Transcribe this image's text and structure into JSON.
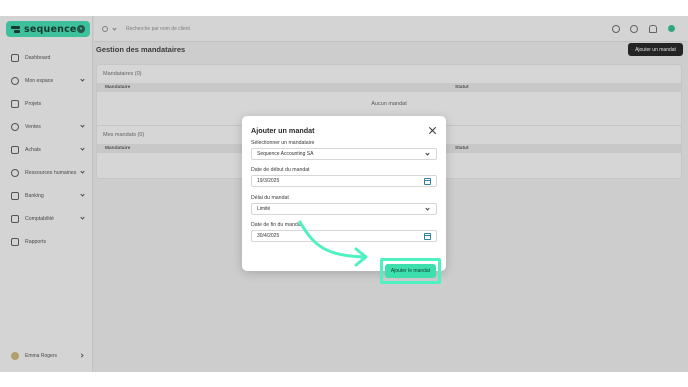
{
  "brand": {
    "name": "sequence",
    "color": "#3dd9ad"
  },
  "sidebar": {
    "items": [
      {
        "label": "Dashboard",
        "icon": "home-icon",
        "chevron": false
      },
      {
        "label": "Mon espace",
        "icon": "person-icon",
        "chevron": true
      },
      {
        "label": "Projets",
        "icon": "checklist-icon",
        "chevron": false
      },
      {
        "label": "Ventes",
        "icon": "wallet-icon",
        "chevron": true
      },
      {
        "label": "Achats",
        "icon": "bag-icon",
        "chevron": true
      },
      {
        "label": "Ressources humaines",
        "icon": "people-icon",
        "chevron": true
      },
      {
        "label": "Banking",
        "icon": "bank-icon",
        "chevron": true
      },
      {
        "label": "Comptabilité",
        "icon": "calculator-icon",
        "chevron": true
      },
      {
        "label": "Rapports",
        "icon": "chart-icon",
        "chevron": false
      }
    ],
    "user": {
      "name": "Emma Rogers"
    }
  },
  "topbar": {
    "search_placeholder": "Recherche par nom de client"
  },
  "page": {
    "title": "Gestion des mandataires",
    "add_button": "Ajouter un mandat"
  },
  "sections": {
    "mandataires": {
      "title": "Mandataires (0)",
      "col_mandataire": "Mandataire",
      "col_statut": "Statut",
      "empty": "Aucun mandat"
    },
    "mes_mandats": {
      "title": "Mes mandats (0)",
      "col_mandataire": "Mandataire",
      "col_statut": "Statut"
    }
  },
  "dialog": {
    "title": "Ajouter un mandat",
    "mandataire_label": "Sélectionner un mandataire",
    "mandataire_value": "Sequence Accounting SA",
    "start_label": "Date de début du mandat",
    "start_value": "19/3/2025",
    "delay_label": "Délai du mandat",
    "delay_value": "Limité",
    "end_label": "Date de fin du mandat",
    "end_value": "30/4/2025",
    "submit": "Ajouter le mandat"
  },
  "highlight_color": "#4ff0c2"
}
